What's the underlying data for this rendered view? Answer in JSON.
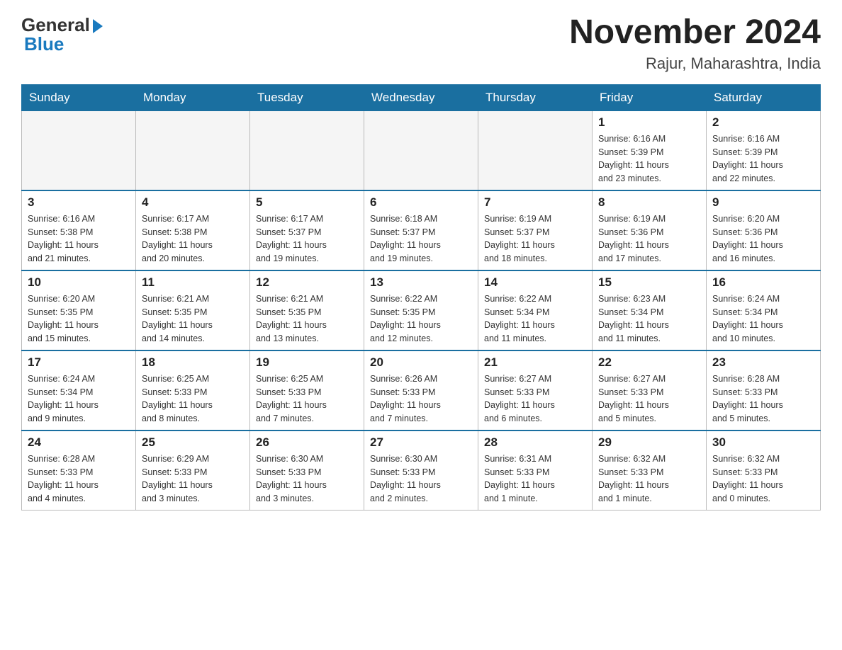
{
  "header": {
    "logo_text": "General",
    "logo_blue": "Blue",
    "month_year": "November 2024",
    "location": "Rajur, Maharashtra, India"
  },
  "days_of_week": [
    "Sunday",
    "Monday",
    "Tuesday",
    "Wednesday",
    "Thursday",
    "Friday",
    "Saturday"
  ],
  "weeks": [
    [
      {
        "day": "",
        "info": ""
      },
      {
        "day": "",
        "info": ""
      },
      {
        "day": "",
        "info": ""
      },
      {
        "day": "",
        "info": ""
      },
      {
        "day": "",
        "info": ""
      },
      {
        "day": "1",
        "info": "Sunrise: 6:16 AM\nSunset: 5:39 PM\nDaylight: 11 hours\nand 23 minutes."
      },
      {
        "day": "2",
        "info": "Sunrise: 6:16 AM\nSunset: 5:39 PM\nDaylight: 11 hours\nand 22 minutes."
      }
    ],
    [
      {
        "day": "3",
        "info": "Sunrise: 6:16 AM\nSunset: 5:38 PM\nDaylight: 11 hours\nand 21 minutes."
      },
      {
        "day": "4",
        "info": "Sunrise: 6:17 AM\nSunset: 5:38 PM\nDaylight: 11 hours\nand 20 minutes."
      },
      {
        "day": "5",
        "info": "Sunrise: 6:17 AM\nSunset: 5:37 PM\nDaylight: 11 hours\nand 19 minutes."
      },
      {
        "day": "6",
        "info": "Sunrise: 6:18 AM\nSunset: 5:37 PM\nDaylight: 11 hours\nand 19 minutes."
      },
      {
        "day": "7",
        "info": "Sunrise: 6:19 AM\nSunset: 5:37 PM\nDaylight: 11 hours\nand 18 minutes."
      },
      {
        "day": "8",
        "info": "Sunrise: 6:19 AM\nSunset: 5:36 PM\nDaylight: 11 hours\nand 17 minutes."
      },
      {
        "day": "9",
        "info": "Sunrise: 6:20 AM\nSunset: 5:36 PM\nDaylight: 11 hours\nand 16 minutes."
      }
    ],
    [
      {
        "day": "10",
        "info": "Sunrise: 6:20 AM\nSunset: 5:35 PM\nDaylight: 11 hours\nand 15 minutes."
      },
      {
        "day": "11",
        "info": "Sunrise: 6:21 AM\nSunset: 5:35 PM\nDaylight: 11 hours\nand 14 minutes."
      },
      {
        "day": "12",
        "info": "Sunrise: 6:21 AM\nSunset: 5:35 PM\nDaylight: 11 hours\nand 13 minutes."
      },
      {
        "day": "13",
        "info": "Sunrise: 6:22 AM\nSunset: 5:35 PM\nDaylight: 11 hours\nand 12 minutes."
      },
      {
        "day": "14",
        "info": "Sunrise: 6:22 AM\nSunset: 5:34 PM\nDaylight: 11 hours\nand 11 minutes."
      },
      {
        "day": "15",
        "info": "Sunrise: 6:23 AM\nSunset: 5:34 PM\nDaylight: 11 hours\nand 11 minutes."
      },
      {
        "day": "16",
        "info": "Sunrise: 6:24 AM\nSunset: 5:34 PM\nDaylight: 11 hours\nand 10 minutes."
      }
    ],
    [
      {
        "day": "17",
        "info": "Sunrise: 6:24 AM\nSunset: 5:34 PM\nDaylight: 11 hours\nand 9 minutes."
      },
      {
        "day": "18",
        "info": "Sunrise: 6:25 AM\nSunset: 5:33 PM\nDaylight: 11 hours\nand 8 minutes."
      },
      {
        "day": "19",
        "info": "Sunrise: 6:25 AM\nSunset: 5:33 PM\nDaylight: 11 hours\nand 7 minutes."
      },
      {
        "day": "20",
        "info": "Sunrise: 6:26 AM\nSunset: 5:33 PM\nDaylight: 11 hours\nand 7 minutes."
      },
      {
        "day": "21",
        "info": "Sunrise: 6:27 AM\nSunset: 5:33 PM\nDaylight: 11 hours\nand 6 minutes."
      },
      {
        "day": "22",
        "info": "Sunrise: 6:27 AM\nSunset: 5:33 PM\nDaylight: 11 hours\nand 5 minutes."
      },
      {
        "day": "23",
        "info": "Sunrise: 6:28 AM\nSunset: 5:33 PM\nDaylight: 11 hours\nand 5 minutes."
      }
    ],
    [
      {
        "day": "24",
        "info": "Sunrise: 6:28 AM\nSunset: 5:33 PM\nDaylight: 11 hours\nand 4 minutes."
      },
      {
        "day": "25",
        "info": "Sunrise: 6:29 AM\nSunset: 5:33 PM\nDaylight: 11 hours\nand 3 minutes."
      },
      {
        "day": "26",
        "info": "Sunrise: 6:30 AM\nSunset: 5:33 PM\nDaylight: 11 hours\nand 3 minutes."
      },
      {
        "day": "27",
        "info": "Sunrise: 6:30 AM\nSunset: 5:33 PM\nDaylight: 11 hours\nand 2 minutes."
      },
      {
        "day": "28",
        "info": "Sunrise: 6:31 AM\nSunset: 5:33 PM\nDaylight: 11 hours\nand 1 minute."
      },
      {
        "day": "29",
        "info": "Sunrise: 6:32 AM\nSunset: 5:33 PM\nDaylight: 11 hours\nand 1 minute."
      },
      {
        "day": "30",
        "info": "Sunrise: 6:32 AM\nSunset: 5:33 PM\nDaylight: 11 hours\nand 0 minutes."
      }
    ]
  ]
}
